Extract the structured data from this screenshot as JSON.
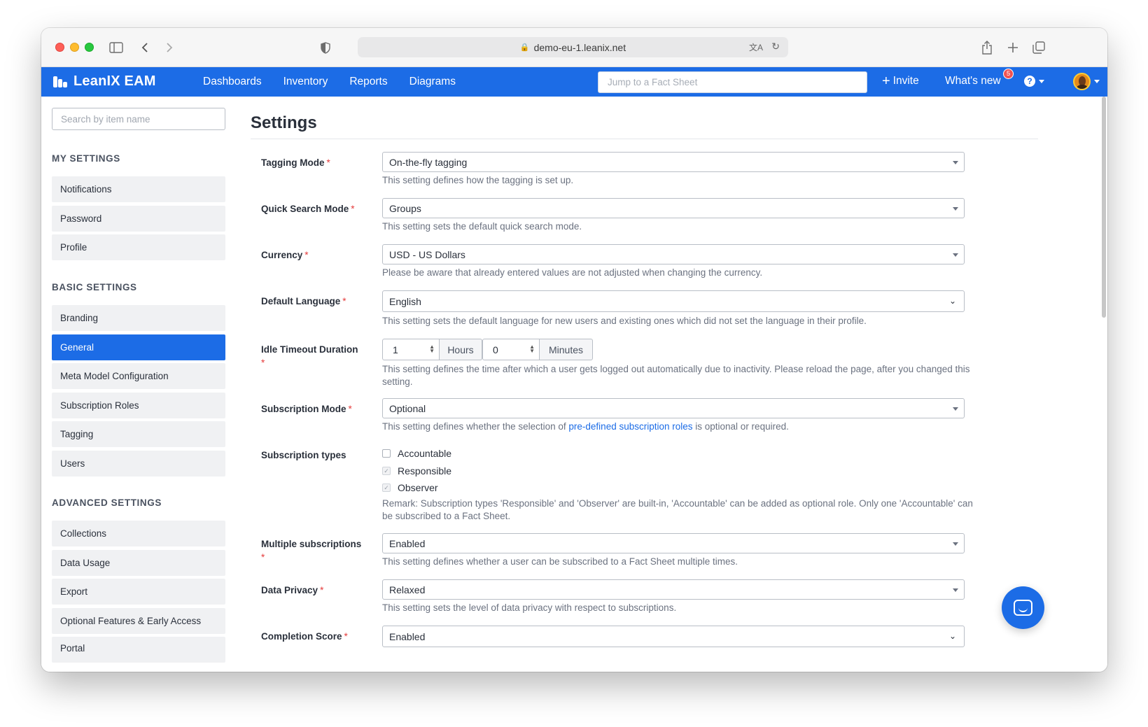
{
  "browser": {
    "url": "demo-eu-1.leanix.net"
  },
  "header": {
    "brand": "LeanIX EAM",
    "nav": [
      "Dashboards",
      "Inventory",
      "Reports",
      "Diagrams"
    ],
    "search_placeholder": "Jump to a Fact Sheet",
    "invite_label": "Invite",
    "whats_new_label": "What's new",
    "whats_new_count": "5",
    "help_icon": "?",
    "accent_color": "#1c6ce6"
  },
  "sidebar": {
    "search_placeholder": "Search by item name",
    "my_settings_title": "MY SETTINGS",
    "my_settings": [
      "Notifications",
      "Password",
      "Profile"
    ],
    "basic_settings_title": "BASIC SETTINGS",
    "basic_settings": [
      "Branding",
      "General",
      "Meta Model Configuration",
      "Subscription Roles",
      "Tagging",
      "Users"
    ],
    "advanced_settings_title": "ADVANCED SETTINGS",
    "advanced_settings": [
      "Collections",
      "Data Usage",
      "Export",
      "Optional Features & Early Access",
      "Portal"
    ],
    "active_item": "General"
  },
  "main": {
    "title": "Settings",
    "tagging_mode": {
      "label": "Tagging Mode",
      "value": "On-the-fly tagging",
      "help": "This setting defines how the tagging is set up."
    },
    "quick_search_mode": {
      "label": "Quick Search Mode",
      "value": "Groups",
      "help": "This setting sets the default quick search mode."
    },
    "currency": {
      "label": "Currency",
      "value": "USD - US Dollars",
      "help": "Please be aware that already entered values are not adjusted when changing the currency."
    },
    "default_language": {
      "label": "Default Language",
      "value": "English",
      "help": "This setting sets the default language for new users and existing ones which did not set the language in their profile."
    },
    "idle_timeout": {
      "label": "Idle Timeout Duration",
      "hours_value": "1",
      "hours_label": "Hours",
      "minutes_value": "0",
      "minutes_label": "Minutes",
      "help": "This setting defines the time after which a user gets logged out automatically due to inactivity. Please reload the page, after you changed this setting."
    },
    "subscription_mode": {
      "label": "Subscription Mode",
      "value": "Optional",
      "help_before": "This setting defines whether the selection of ",
      "help_link": "pre-defined subscription roles",
      "help_after": " is optional or required."
    },
    "subscription_types": {
      "label": "Subscription types",
      "options": [
        "Accountable",
        "Responsible",
        "Observer"
      ],
      "remark": "Remark: Subscription types 'Responsible' and 'Observer' are built-in, 'Accountable' can be added as optional role. Only one 'Accountable' can be subscribed to a Fact Sheet."
    },
    "multiple_subscriptions": {
      "label": "Multiple subscriptions",
      "value": "Enabled",
      "help": "This setting defines whether a user can be subscribed to a Fact Sheet multiple times."
    },
    "data_privacy": {
      "label": "Data Privacy",
      "value": "Relaxed",
      "help": "This setting sets the level of data privacy with respect to subscriptions."
    },
    "completion_score": {
      "label": "Completion Score",
      "value": "Enabled"
    },
    "required_mark": "*"
  }
}
